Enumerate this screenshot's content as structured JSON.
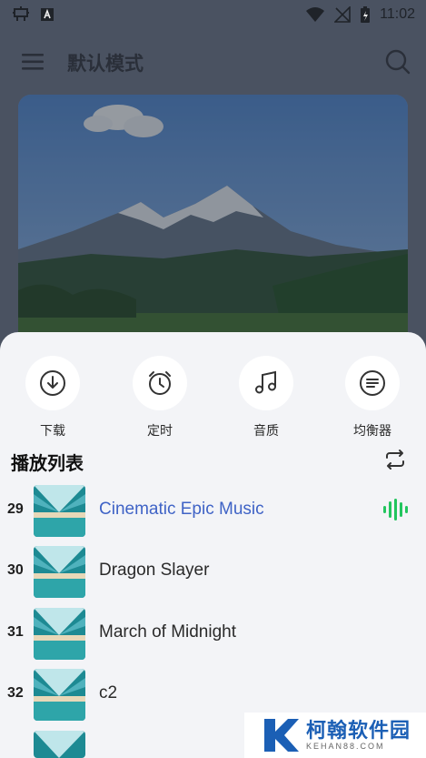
{
  "status_bar": {
    "time": "11:02",
    "icons": [
      "app-bug-icon",
      "notification-a-icon",
      "wifi-icon",
      "no-signal-icon",
      "battery-charging-icon"
    ]
  },
  "app_bar": {
    "title": "默认模式",
    "menu_icon": "menu-icon",
    "search_icon": "search-icon"
  },
  "sheet": {
    "actions": [
      {
        "label": "下载",
        "icon": "download-icon"
      },
      {
        "label": "定时",
        "icon": "alarm-clock-icon"
      },
      {
        "label": "音质",
        "icon": "music-note-icon"
      },
      {
        "label": "均衡器",
        "icon": "equalizer-list-icon"
      }
    ],
    "playlist_title": "播放列表",
    "repeat_icon": "repeat-icon",
    "tracks": [
      {
        "number": "29",
        "title": "Cinematic Epic Music",
        "active": true
      },
      {
        "number": "30",
        "title": "Dragon Slayer",
        "active": false
      },
      {
        "number": "31",
        "title": "March of Midnight",
        "active": false
      },
      {
        "number": "32",
        "title": "c2",
        "active": false
      }
    ]
  },
  "colors": {
    "accent": "#3f63c6",
    "playing": "#22c55e",
    "sheet_bg": "#f3f4f7"
  },
  "watermark": {
    "name": "柯翰软件园",
    "sub": "KEHAN88.COM"
  }
}
